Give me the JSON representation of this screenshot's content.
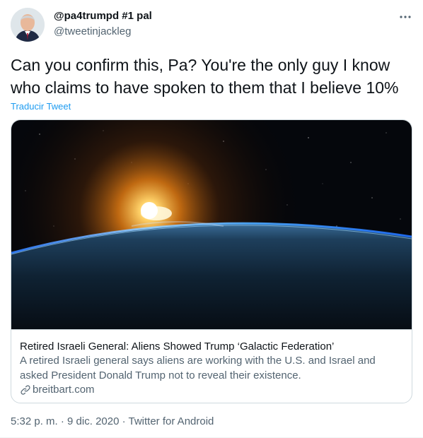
{
  "author": {
    "display_name": "@pa4trumpd #1 pal",
    "handle": "@tweetinjackleg"
  },
  "tweet": {
    "text": "Can you confirm this, Pa? You're the only guy I know who claims to have spoken to them that I believe 10%",
    "translate_label": "Traducir Tweet"
  },
  "card": {
    "title": "Retired Israeli General: Aliens Showed Trump ‘Galactic Federation’",
    "description": "A retired Israeli general says aliens are working with the U.S. and Israel and asked President Donald Trump not to reveal their existence.",
    "domain": "breitbart.com"
  },
  "meta": {
    "time": "5:32 p. m.",
    "separator1": " · ",
    "date": "9 dic. 2020",
    "separator2": " · ",
    "source": "Twitter for Android"
  },
  "icons": {
    "more": "more-dots-icon",
    "link": "link-icon"
  },
  "colors": {
    "accent": "#1d9bf0",
    "secondary_text": "#536471",
    "border": "#cfd9de"
  }
}
